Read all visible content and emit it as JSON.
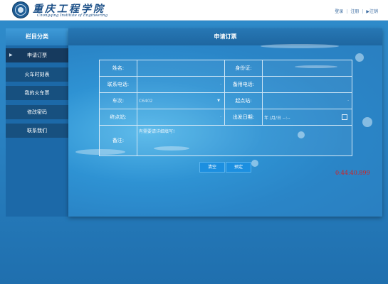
{
  "header": {
    "school_name_cn": "重庆工程学院",
    "school_name_en": "Chongqing Institute of Engineering",
    "links": [
      "登录",
      "注册",
      "▶注销"
    ]
  },
  "sidebar": {
    "title": "栏目分类",
    "items": [
      {
        "label": "申请订票",
        "active": true
      },
      {
        "label": "火车时刻表",
        "active": false
      },
      {
        "label": "我的火车票",
        "active": false
      },
      {
        "label": "修改密码",
        "active": false
      },
      {
        "label": "联系我们",
        "active": false
      }
    ]
  },
  "main": {
    "title": "申请订票",
    "form": {
      "name_label": "姓名:",
      "id_label": "身份证:",
      "phone_label": "联系电话:",
      "backup_phone_label": "备用电话:",
      "train_label": "车次:",
      "train_value": "C6402",
      "start_label": "起点站:",
      "end_label": "终点站:",
      "date_label": "出发日期:",
      "date_placeholder": "年 /月/日 --:--",
      "remark_label": "备注:",
      "remark_value": "有需要请详细填写!"
    },
    "buttons": {
      "clear": "清空",
      "submit": "预定"
    }
  },
  "counter_text": "0:44:40.899",
  "colors": {
    "accent": "#1c8fe0",
    "sidebar_item": "#17507f",
    "sidebar_active": "#163a5e",
    "counter": "#d62020"
  }
}
